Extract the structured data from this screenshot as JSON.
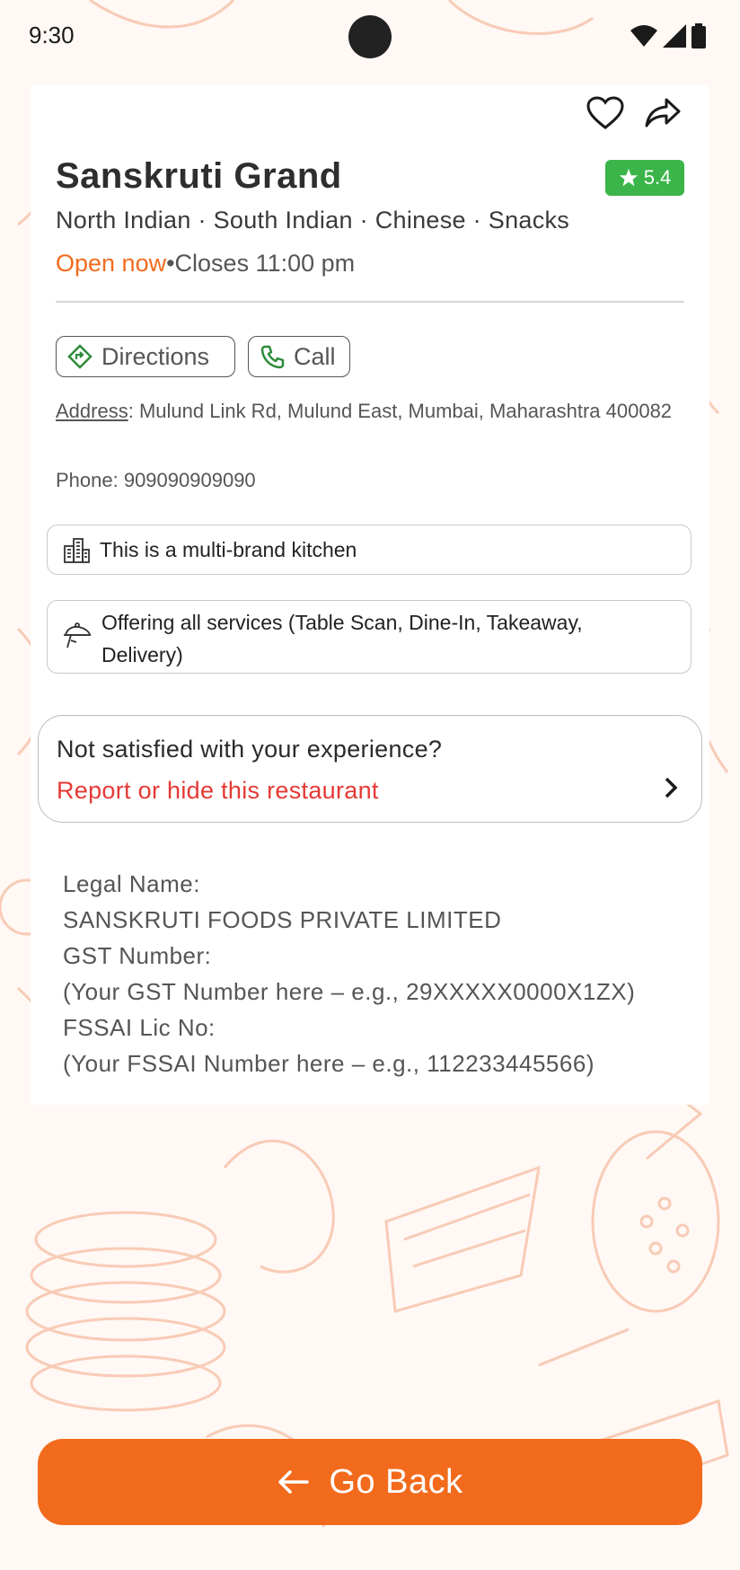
{
  "status": {
    "time": "9:30"
  },
  "restaurant": {
    "name": "Sanskruti Grand",
    "rating": "5.4",
    "cuisines": "North Indian · South Indian · Chinese · Snacks",
    "open_status": "Open now",
    "separator": "•",
    "closes": "Closes 11:00 pm"
  },
  "actions": {
    "directions": "Directions",
    "call": "Call"
  },
  "contact": {
    "address_label": "Address",
    "address": ": Mulund Link Rd, Mulund East, Mumbai, Maharashtra 400082",
    "phone": "Phone: 909090909090"
  },
  "info": {
    "multi_brand": "This is a multi-brand kitchen",
    "services": "Offering all services (Table Scan, Dine-In, Takeaway, Delivery)"
  },
  "report": {
    "question": "Not satisfied with your experience?",
    "link": "Report or hide this restaurant"
  },
  "legal": {
    "legal_name_label": "Legal Name:",
    "legal_name": "SANSKRUTI FOODS PRIVATE LIMITED",
    "gst_label": "GST Number:",
    "gst": "(Your GST Number here – e.g., 29XXXXX0000X1ZX)",
    "fssai_label": "FSSAI Lic No:",
    "fssai": "(Your FSSAI Number here – e.g., 112233445566)"
  },
  "footer": {
    "go_back": "Go Back"
  },
  "colors": {
    "accent": "#f26b1d",
    "rating": "#3bb54a",
    "danger": "#e53935",
    "pattern": "#fad3c2"
  }
}
